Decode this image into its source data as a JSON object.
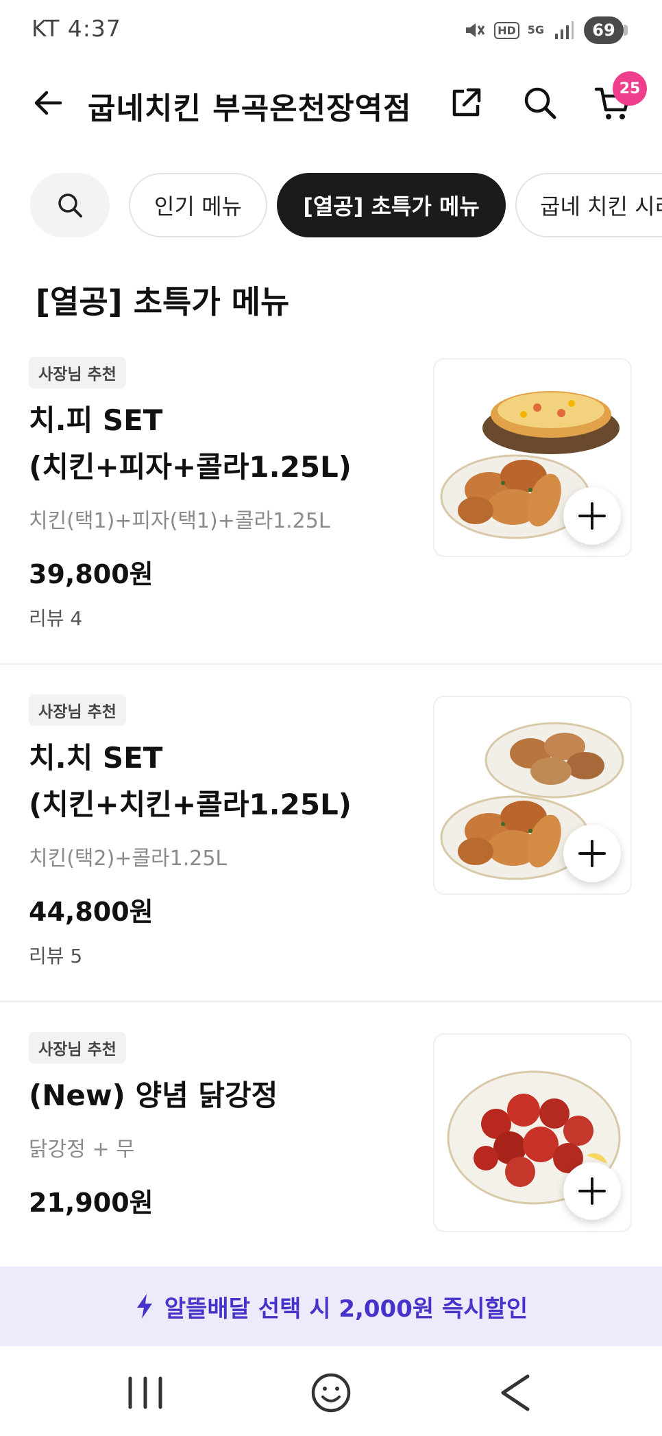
{
  "status_bar": {
    "carrier_time": "KT 4:37",
    "hd_label": "HD",
    "network_label": "5G",
    "battery": "69"
  },
  "header": {
    "title": "굽네치킨 부곡온천장역점",
    "cart_count": "25"
  },
  "tabs": [
    {
      "label": "인기 메뉴"
    },
    {
      "label": "[열공] 초특가 메뉴"
    },
    {
      "label": "굽네 치킨 시리즈"
    }
  ],
  "section": {
    "title": "[열공] 초특가 메뉴"
  },
  "items": [
    {
      "badge": "사장님 추천",
      "name_line1": "치.피 SET",
      "name_line2": "(치킨+피자+콜라1.25L)",
      "description": "치킨(택1)+피자(택1)+콜라1.25L",
      "price": "39,800원",
      "review": "리뷰 4"
    },
    {
      "badge": "사장님 추천",
      "name_line1": "치.치 SET",
      "name_line2": "(치킨+치킨+콜라1.25L)",
      "description": "치킨(택2)+콜라1.25L",
      "price": "44,800원",
      "review": "리뷰 5"
    },
    {
      "badge": "사장님 추천",
      "name_line1": "(New) 양념 닭강정",
      "name_line2": "",
      "description": "닭강정 + 무",
      "price": "21,900원",
      "review": ""
    }
  ],
  "promo": {
    "text": "알뜰배달 선택 시 2,000원 즉시할인",
    "accent": "#4633c9"
  },
  "colors": {
    "active_tab": "#1b1b1d",
    "cart_badge": "#ef3f8c"
  }
}
